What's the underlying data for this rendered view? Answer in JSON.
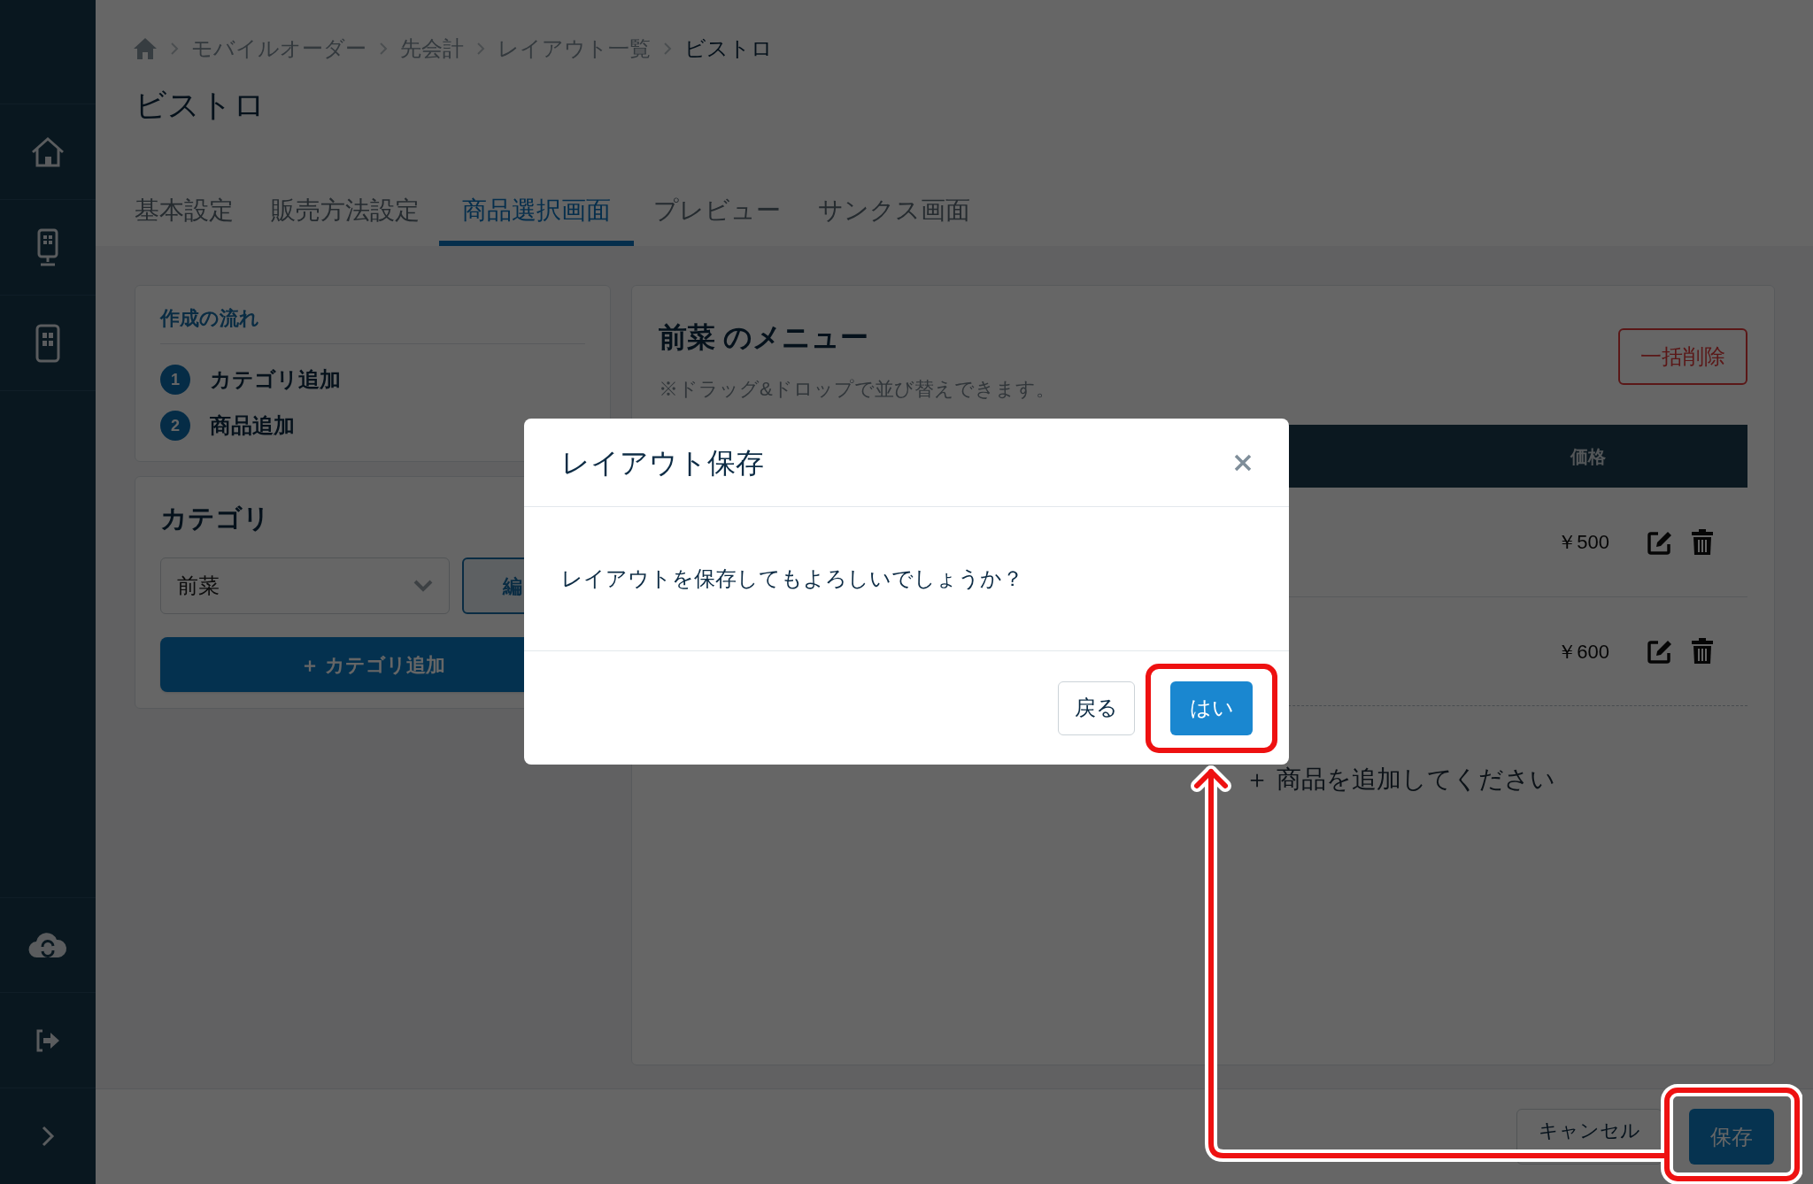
{
  "breadcrumb": [
    "モバイルオーダー",
    "先会計",
    "レイアウト一覧",
    "ビストロ"
  ],
  "page_title": "ビストロ",
  "tabs": [
    {
      "label": "基本設定",
      "selected": false
    },
    {
      "label": "販売方法設定",
      "selected": false
    },
    {
      "label": "商品選択画面",
      "selected": true
    },
    {
      "label": "プレビュー",
      "selected": false
    },
    {
      "label": "サンクス画面",
      "selected": false
    }
  ],
  "flow": {
    "title": "作成の流れ",
    "steps": [
      {
        "number": "1",
        "label": "カテゴリ追加"
      },
      {
        "number": "2",
        "label": "商品追加"
      }
    ]
  },
  "category": {
    "title": "カテゴリ",
    "select_value": "前菜",
    "edit_button": "編",
    "add_button": "＋ カテゴリ追加"
  },
  "menu": {
    "title": "前菜 のメニュー",
    "bulk_delete": "一括削除",
    "note": "※ドラッグ&ドロップで並び替えできます。",
    "columns": [
      "価格"
    ],
    "rows": [
      {
        "price": "￥500"
      },
      {
        "price": "￥600"
      }
    ],
    "add_item": "＋ 商品を追加してください"
  },
  "footer": {
    "buttons": [
      {
        "label": "キャンセル",
        "kind": "secondary"
      },
      {
        "label": "保存",
        "kind": "primary"
      }
    ]
  },
  "dialog": {
    "title": "レイアウト保存",
    "message": "レイアウトを保存してもよろしいでしょうか？",
    "buttons": [
      {
        "label": "戻る",
        "kind": "secondary"
      },
      {
        "label": "はい",
        "kind": "primary"
      }
    ]
  }
}
